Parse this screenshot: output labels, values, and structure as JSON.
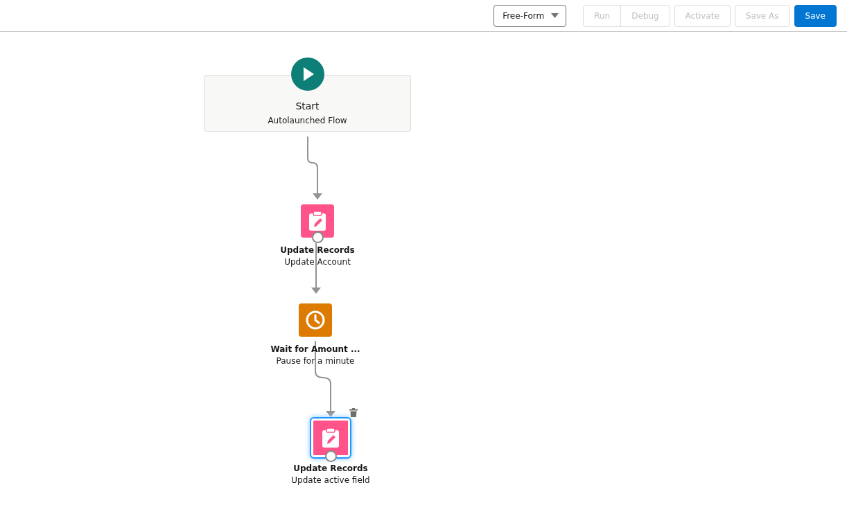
{
  "toolbar": {
    "layout_menu": {
      "label": "Free-Form"
    },
    "button_groups": [
      [
        {
          "label": "Run",
          "kind": "neutral",
          "disabled": true
        },
        {
          "label": "Debug",
          "kind": "neutral",
          "disabled": true
        }
      ],
      [
        {
          "label": "Activate",
          "kind": "neutral",
          "disabled": true
        }
      ],
      [
        {
          "label": "Save As",
          "kind": "neutral",
          "disabled": true
        }
      ],
      [
        {
          "label": "Save",
          "kind": "brand",
          "disabled": false
        }
      ]
    ]
  },
  "canvas": {
    "start": {
      "title": "Start",
      "subtitle": "Autolaunched Flow"
    },
    "elements": [
      {
        "kind": "update",
        "title": "Update Records",
        "subtitle": "Update Account",
        "selected": false
      },
      {
        "kind": "wait",
        "title": "Wait for Amount ...",
        "subtitle": "Pause for a minute",
        "selected": false
      },
      {
        "kind": "update",
        "title": "Update Records",
        "subtitle": "Update active field",
        "selected": true
      }
    ]
  }
}
